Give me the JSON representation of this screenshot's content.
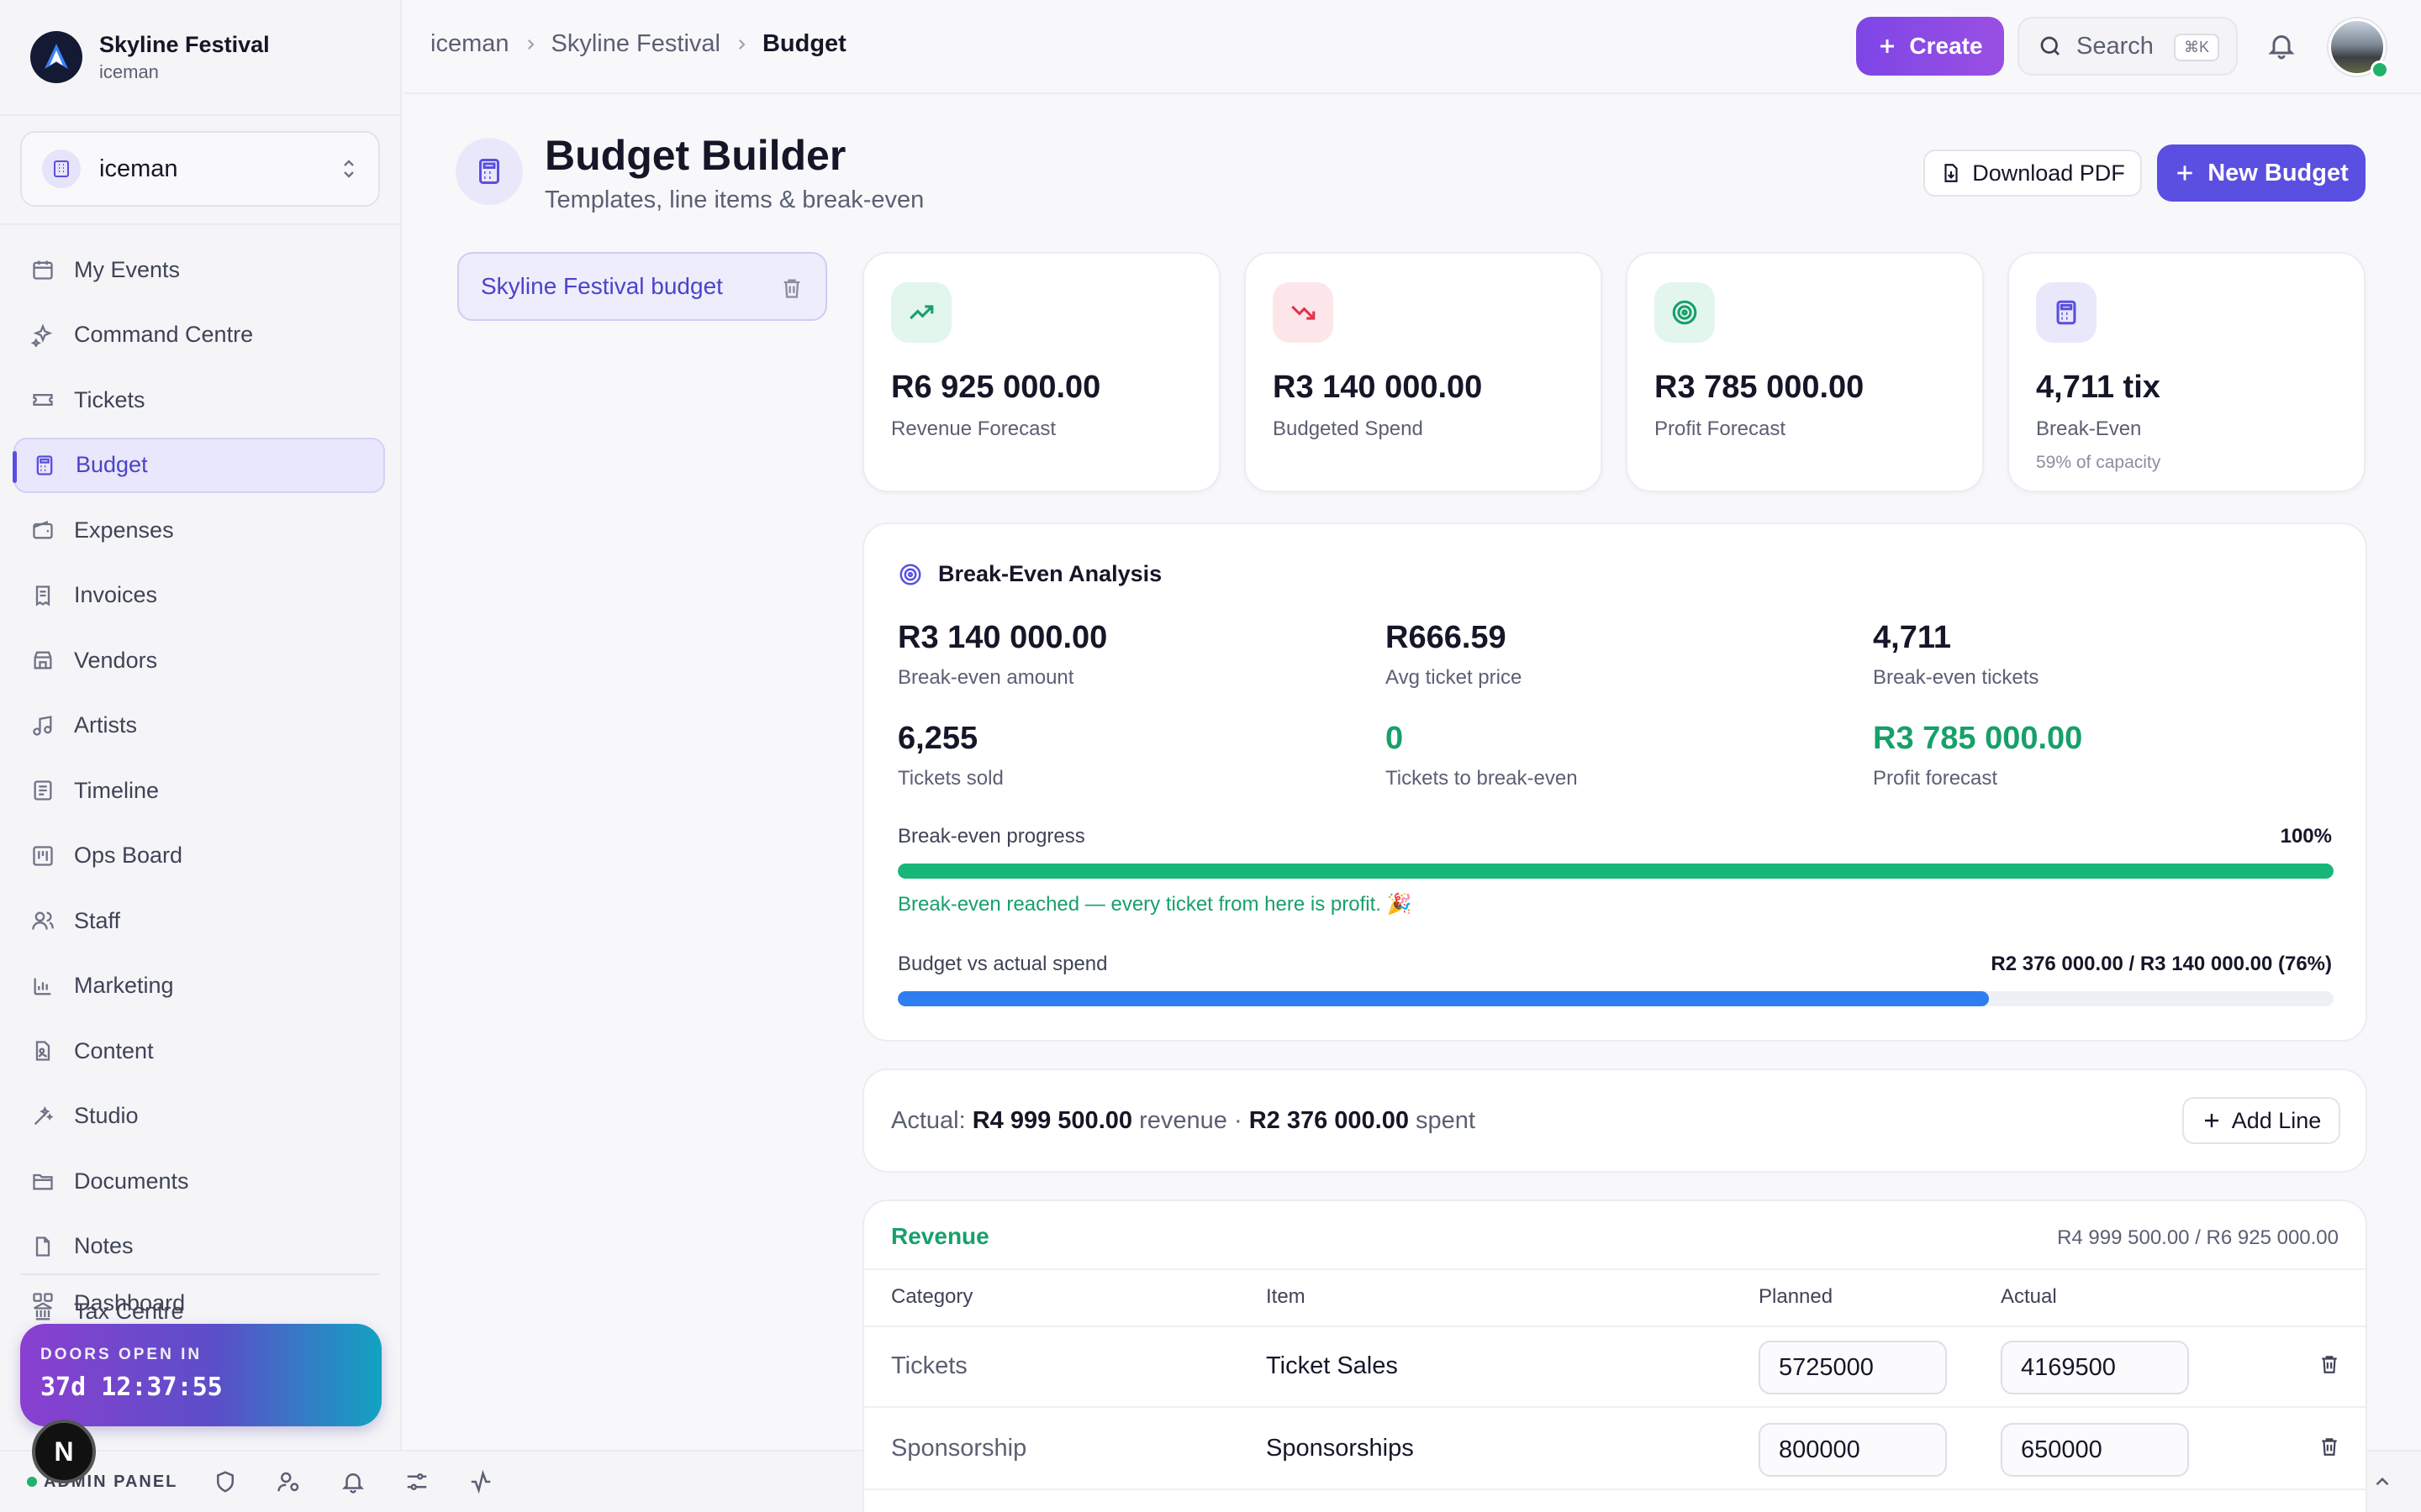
{
  "brand": {
    "name": "Skyline Festival",
    "sub": "iceman"
  },
  "org": {
    "name": "iceman"
  },
  "nav": {
    "items": [
      {
        "label": "My Events",
        "icon": "calendar-icon"
      },
      {
        "label": "Command Centre",
        "icon": "sparkles-icon"
      },
      {
        "label": "Tickets",
        "icon": "ticket-icon"
      },
      {
        "label": "Budget",
        "icon": "calculator-icon",
        "active": true
      },
      {
        "label": "Expenses",
        "icon": "wallet-icon"
      },
      {
        "label": "Invoices",
        "icon": "receipt-icon"
      },
      {
        "label": "Vendors",
        "icon": "store-icon"
      },
      {
        "label": "Artists",
        "icon": "music-note-icon"
      },
      {
        "label": "Timeline",
        "icon": "list-icon"
      },
      {
        "label": "Ops Board",
        "icon": "kanban-icon"
      },
      {
        "label": "Staff",
        "icon": "users-icon"
      },
      {
        "label": "Marketing",
        "icon": "bar-chart-icon"
      },
      {
        "label": "Content",
        "icon": "file-image-icon"
      },
      {
        "label": "Studio",
        "icon": "magic-wand-icon"
      },
      {
        "label": "Documents",
        "icon": "folder-icon"
      },
      {
        "label": "Notes",
        "icon": "file-icon"
      },
      {
        "label": "Tax Centre",
        "icon": "bank-icon"
      }
    ],
    "cut_item": "Dashboard"
  },
  "countdown": {
    "label": "DOORS OPEN IN",
    "time": "37d 12:37:55"
  },
  "bottombar": {
    "admin_label": "ADMIN PANEL",
    "collapse_label": "Collapse"
  },
  "breadcrumb": {
    "items": [
      "iceman",
      "Skyline Festival"
    ],
    "current": "Budget"
  },
  "topbar": {
    "create_label": "Create",
    "search_label": "Search",
    "search_shortcut": "⌘K"
  },
  "page": {
    "title": "Budget Builder",
    "subtitle": "Templates, line items & break-even",
    "download_label": "Download PDF",
    "new_budget_label": "New Budget"
  },
  "budgets": {
    "selected": "Skyline Festival budget"
  },
  "stats": [
    {
      "value": "R6 925 000.00",
      "label": "Revenue Forecast",
      "icon": "trending-up-icon",
      "color": "#17a06a",
      "bg": "#e3f6ee"
    },
    {
      "value": "R3 140 000.00",
      "label": "Budgeted Spend",
      "icon": "trending-down-icon",
      "color": "#e0334f",
      "bg": "#fde6ea"
    },
    {
      "value": "R3 785 000.00",
      "label": "Profit Forecast",
      "icon": "target-icon",
      "color": "#17a06a",
      "bg": "#e3f6ee"
    },
    {
      "value": "4,711 tix",
      "label": "Break-Even",
      "note": "59% of capacity",
      "icon": "calculator-icon",
      "color": "#5a4fe0",
      "bg": "#e9e8fb"
    }
  ],
  "break_even": {
    "title": "Break-Even Analysis",
    "metrics": [
      {
        "value": "R3 140 000.00",
        "label": "Break-even amount"
      },
      {
        "value": "R666.59",
        "label": "Avg ticket price"
      },
      {
        "value": "4,711",
        "label": "Break-even tickets"
      },
      {
        "value": "6,255",
        "label": "Tickets sold"
      },
      {
        "value": "0",
        "label": "Tickets to break-even"
      },
      {
        "value": "R3 785 000.00",
        "label": "Profit forecast"
      }
    ],
    "progress_label": "Break-even progress",
    "progress_text": "100%",
    "progress_value": 1.0,
    "message": "Break-even reached — every ticket from here is profit. 🎉",
    "spend_label": "Budget vs actual spend",
    "spend_text": "R2 376 000.00 / R3 140 000.00 (76%)",
    "spend_value": 0.76
  },
  "actual": {
    "prefix": "Actual:",
    "revenue": "R4 999 500.00",
    "revenue_word": "revenue",
    "dot": "·",
    "spent": "R2 376 000.00",
    "spent_word": "spent",
    "add_line_label": "Add Line"
  },
  "revenue": {
    "title": "Revenue",
    "totals": "R4 999 500.00 / R6 925 000.00",
    "columns": [
      "Category",
      "Item",
      "Planned",
      "Actual"
    ],
    "rows": [
      {
        "category": "Tickets",
        "item": "Ticket Sales",
        "planned": "5725000",
        "actual": "4169500"
      },
      {
        "category": "Sponsorship",
        "item": "Sponsorships",
        "planned": "800000",
        "actual": "650000"
      }
    ]
  }
}
